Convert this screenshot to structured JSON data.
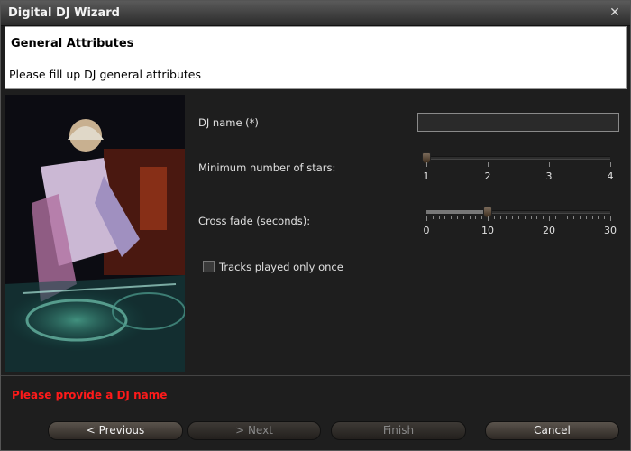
{
  "window": {
    "title": "Digital DJ Wizard",
    "close_glyph": "✕"
  },
  "header": {
    "title": "General Attributes",
    "description": "Please fill up DJ general attributes"
  },
  "form": {
    "dj_name_label": "DJ name (*)",
    "dj_name_value": "",
    "stars_label": "Minimum number of stars:",
    "stars_ticks": [
      "1",
      "2",
      "3",
      "4"
    ],
    "stars_value": 1,
    "crossfade_label": "Cross fade (seconds):",
    "crossfade_ticks": [
      "0",
      "10",
      "20",
      "30"
    ],
    "crossfade_value": 10,
    "tracks_once_label": "Tracks played only once",
    "tracks_once_checked": false
  },
  "status": {
    "error": "Please provide a DJ name",
    "error_color": "#ff1a1a"
  },
  "buttons": {
    "previous": "< Previous",
    "next": "> Next",
    "finish": "Finish",
    "cancel": "Cancel"
  },
  "image": {
    "subject": "dj-photo"
  }
}
